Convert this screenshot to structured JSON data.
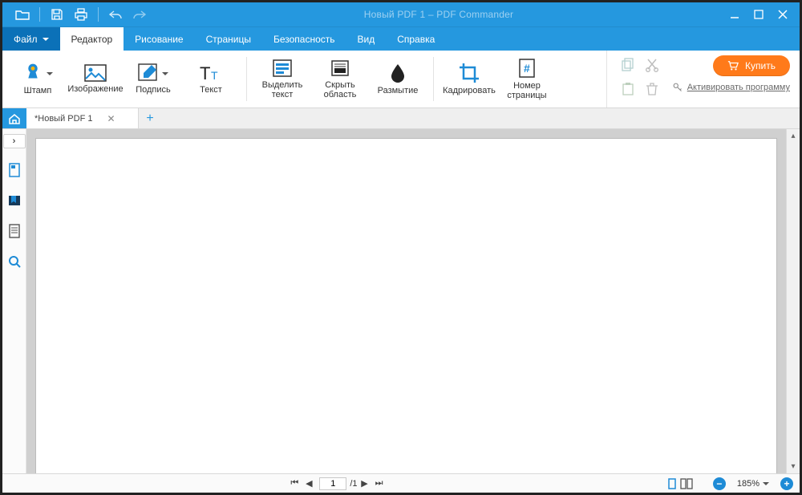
{
  "window": {
    "title": "Новый PDF 1 – PDF Commander"
  },
  "menubar": {
    "file": "Файл",
    "editor": "Редактор",
    "drawing": "Рисование",
    "pages": "Страницы",
    "security": "Безопасность",
    "view": "Вид",
    "help": "Справка"
  },
  "ribbon": {
    "stamp": "Штамп",
    "image": "Изображение",
    "signature": "Подпись",
    "text": "Текст",
    "highlight": "Выделить текст",
    "hidearea": "Скрыть область",
    "blur": "Размытие",
    "crop": "Кадрировать",
    "pagenum": "Номер страницы",
    "buy": "Купить",
    "activate": "Активировать программу"
  },
  "doc_tab": {
    "title": "*Новый PDF 1"
  },
  "status": {
    "page_current": "1",
    "page_sep": "/1",
    "zoom": "185%"
  }
}
